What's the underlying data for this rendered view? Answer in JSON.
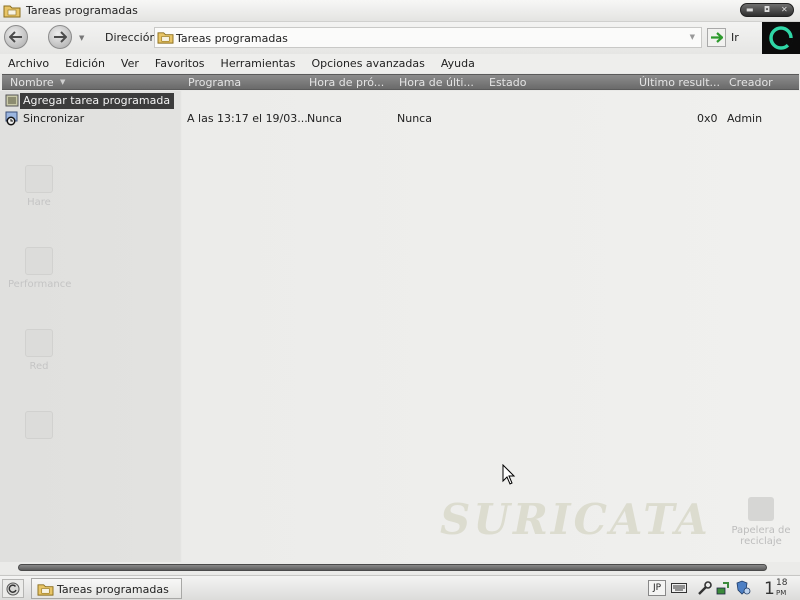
{
  "window": {
    "title": "Tareas programadas"
  },
  "navigation": {
    "address_label": "Dirección",
    "address_value": "Tareas programadas",
    "go_label": "Ir"
  },
  "menu": {
    "items": [
      "Archivo",
      "Edición",
      "Ver",
      "Favoritos",
      "Herramientas",
      "Opciones avanzadas",
      "Ayuda"
    ]
  },
  "table": {
    "columns": [
      "Nombre",
      "Programa",
      "Hora de pró...",
      "Hora de últi...",
      "Estado",
      "Último result...",
      "Creador"
    ],
    "rows": [
      {
        "name": "Agregar tarea programada",
        "icon": "add-task-icon",
        "selected": true
      },
      {
        "name": "Sincronizar",
        "icon": "sync-task-icon",
        "schedule": "A las 13:17 el 19/03...",
        "next_run": "Nunca",
        "last_run": "Nunca",
        "status": "",
        "last_result": "0x0",
        "creator": "Admin"
      }
    ]
  },
  "desktop": {
    "icons": [
      "Hare",
      "Performance",
      "Red"
    ],
    "recycle_bin": "Papelera de reciclaje",
    "watermark": "SURICATA"
  },
  "taskbar": {
    "task_button": "Tareas programadas",
    "language": "JP",
    "clock_hour": "1",
    "clock_minutes": "18",
    "clock_ampm": "PM"
  },
  "colors": {
    "header_bg": "#7a7a7a",
    "selection_bg": "#3c3c3c",
    "go_arrow": "#2e9a2e",
    "throbber_ring": "#2fd6a6"
  }
}
